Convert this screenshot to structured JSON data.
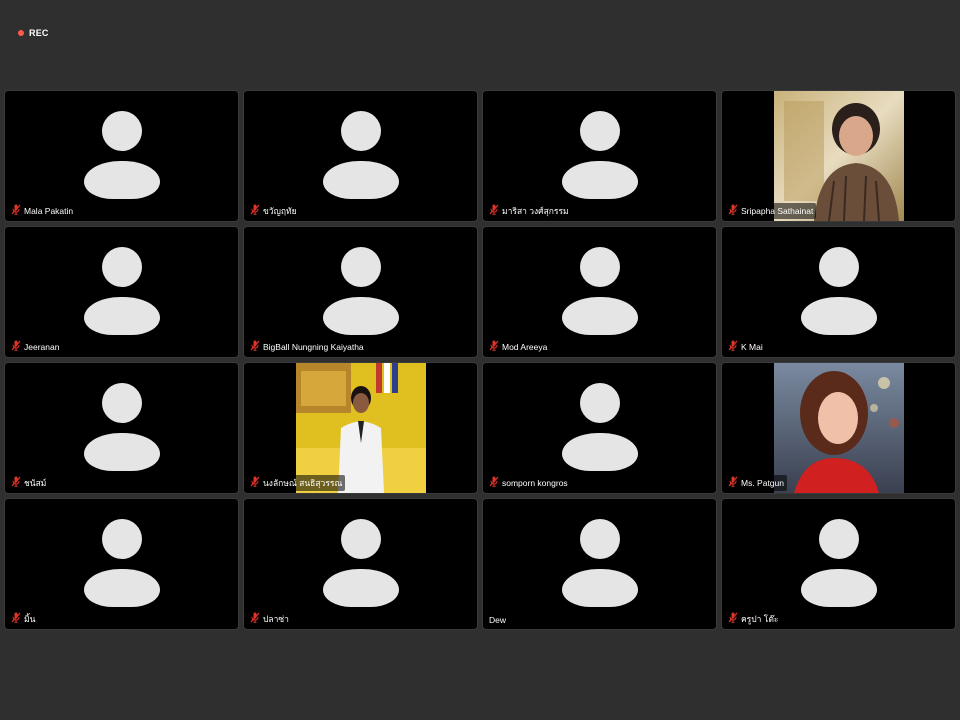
{
  "recording": {
    "label": "REC",
    "dot_color": "#ff5a4f"
  },
  "participants": [
    {
      "name": "Mala Pakatin",
      "muted": true,
      "video": false
    },
    {
      "name": "ขวัญฤทัย",
      "muted": true,
      "video": false
    },
    {
      "name": "มาริสา วงศ์สุกรรม",
      "muted": true,
      "video": false
    },
    {
      "name": "Sripapha Sathainat",
      "muted": true,
      "video": true,
      "video_desc": "woman-smiling-photo"
    },
    {
      "name": "Jeeranan",
      "muted": true,
      "video": false
    },
    {
      "name": "BigBall Nungning Kaiyatha",
      "muted": true,
      "video": false
    },
    {
      "name": "Mod Areeya",
      "muted": true,
      "video": false
    },
    {
      "name": "K Mai",
      "muted": true,
      "video": false
    },
    {
      "name": "ชนัสม์",
      "muted": true,
      "video": false
    },
    {
      "name": "นงลักษณ์ สนธิสุวรรณ",
      "muted": true,
      "video": true,
      "video_desc": "person-in-white-uniform-photo"
    },
    {
      "name": "somporn kongros",
      "muted": true,
      "video": false
    },
    {
      "name": "Ms. Patgun",
      "muted": true,
      "video": true,
      "video_desc": "woman-portrait-photo"
    },
    {
      "name": "มิ้น",
      "muted": true,
      "video": false
    },
    {
      "name": "ปลาซ่า",
      "muted": true,
      "video": false
    },
    {
      "name": "Dew",
      "muted": false,
      "video": false
    },
    {
      "name": "ครูปา โต๊ะ",
      "muted": true,
      "video": false
    }
  ],
  "colors": {
    "background": "#2f2f2f",
    "tile": "#000000",
    "avatar": "#e5e5e5",
    "muted_icon": "#e0342b"
  }
}
